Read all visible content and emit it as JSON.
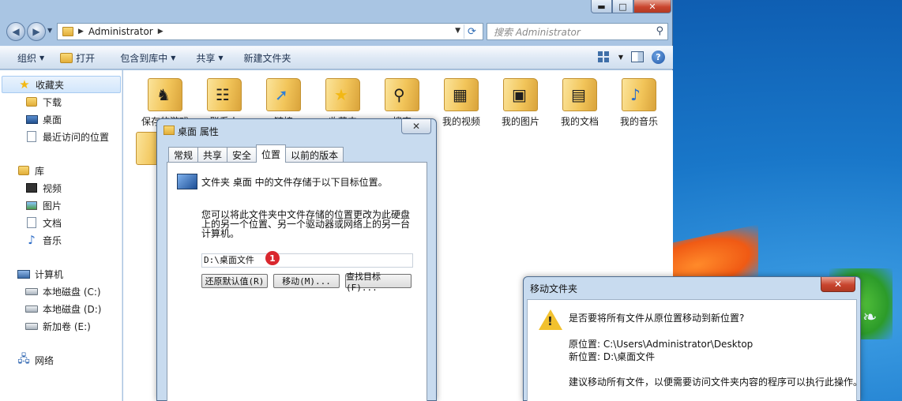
{
  "explorer": {
    "address": {
      "crumb": "Administrator"
    },
    "search_placeholder": "搜索 Administrator",
    "toolbar": {
      "organize": "组织",
      "open": "打开",
      "include_library": "包含到库中",
      "share": "共享",
      "new_folder": "新建文件夹"
    },
    "nav": {
      "favorites": "收藏夹",
      "favorites_items": [
        "下载",
        "桌面",
        "最近访问的位置"
      ],
      "libraries": "库",
      "libraries_items": [
        "视频",
        "图片",
        "文档",
        "音乐"
      ],
      "computer": "计算机",
      "computer_items": [
        "本地磁盘 (C:)",
        "本地磁盘 (D:)",
        "新加卷 (E:)"
      ],
      "network": "网络"
    },
    "files": [
      "保存的游戏",
      "联系人",
      "链接",
      "收藏夹",
      "搜索",
      "我的视频",
      "我的图片",
      "我的文档",
      "我的音乐"
    ]
  },
  "props_dialog": {
    "title": "桌面 属性",
    "tabs": [
      "常规",
      "共享",
      "安全",
      "位置",
      "以前的版本"
    ],
    "active_tab": "位置",
    "line1": "文件夹 桌面 中的文件存储于以下目标位置。",
    "description": "您可以将此文件夹中文件存储的位置更改为此硬盘上的另一个位置、另一个驱动器或网络上的另一台计算机。",
    "path_value": "D:\\桌面文件",
    "badge": "1",
    "restore_button": "还原默认值(R)",
    "move_button": "移动(M)...",
    "find_button": "查找目标(F)..."
  },
  "move_dialog": {
    "title": "移动文件夹",
    "question": "是否要将所有文件从原位置移动到新位置?",
    "from": "原位置: C:\\Users\\Administrator\\Desktop",
    "to": "新位置: D:\\桌面文件",
    "advice": "建议移动所有文件，以便需要访问文件夹内容的程序可以执行此操作。"
  }
}
